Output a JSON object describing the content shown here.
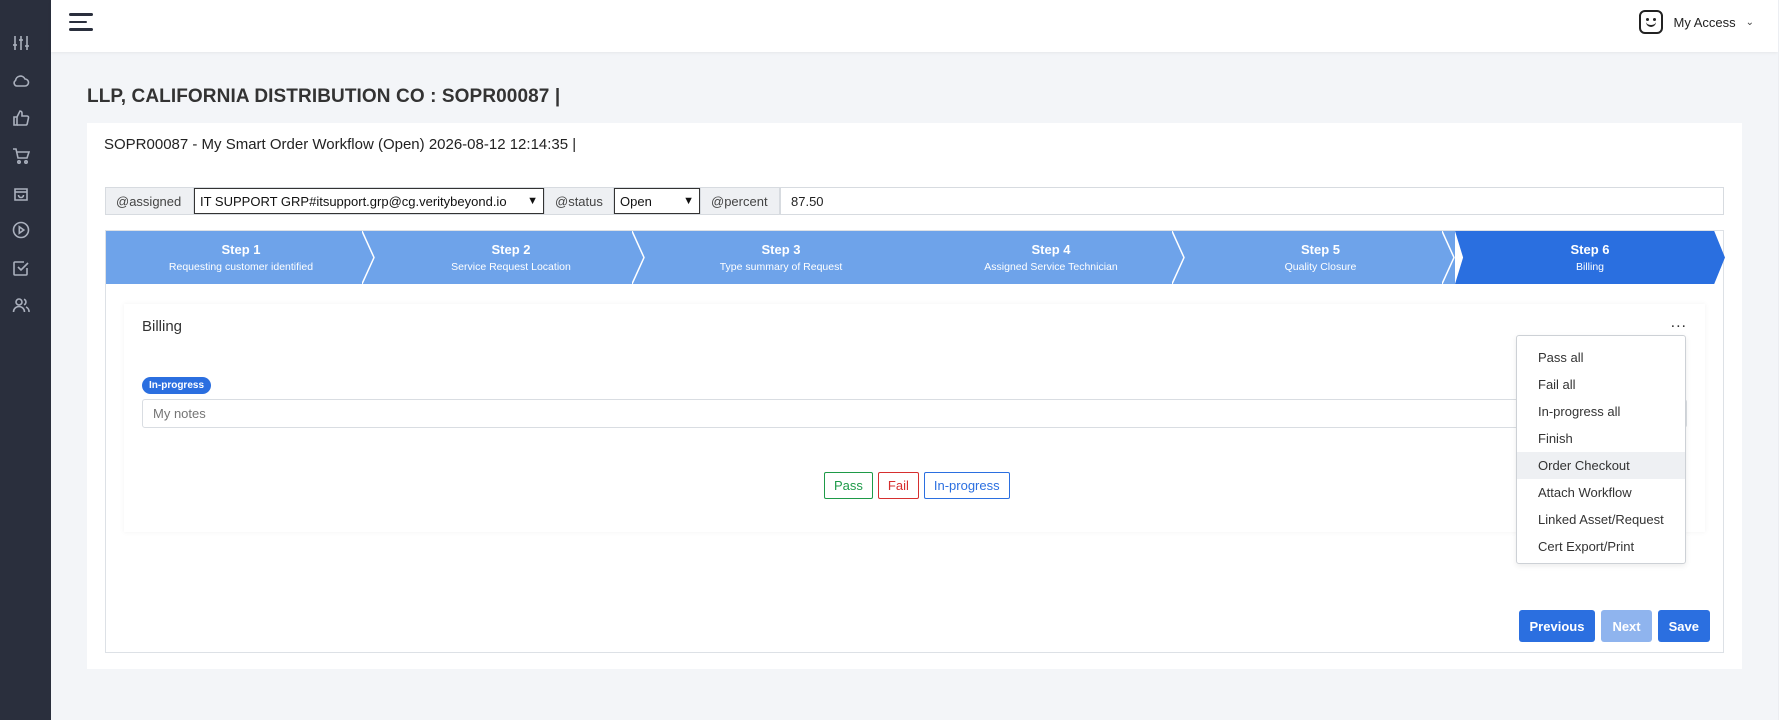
{
  "header": {
    "user_label": "My Access",
    "chevron": "⌄"
  },
  "sidebar": {
    "icons": [
      "sliders-icon",
      "cloud-icon",
      "thumbs-up-icon",
      "cart-icon",
      "bag-icon",
      "play-icon",
      "checkbox-icon",
      "users-icon"
    ]
  },
  "page": {
    "title": "LLP, CALIFORNIA DISTRIBUTION CO : SOPR00087 |",
    "workflow_title": "SOPR00087 - My Smart Order Workflow (Open) 2026-08-12 12:14:35 |"
  },
  "fields": {
    "assigned_label": "@assigned",
    "assigned_value": "IT SUPPORT GRP#itsupport.grp@cg.veritybeyond.io",
    "status_label": "@status",
    "status_value": "Open",
    "percent_label": "@percent",
    "percent_value": "87.50"
  },
  "steps": [
    {
      "num": "Step 1",
      "desc": "Requesting customer identified"
    },
    {
      "num": "Step 2",
      "desc": "Service Request Location"
    },
    {
      "num": "Step 3",
      "desc": "Type summary of Request"
    },
    {
      "num": "Step 4",
      "desc": "Assigned Service Technician"
    },
    {
      "num": "Step 5",
      "desc": "Quality Closure"
    },
    {
      "num": "Step 6",
      "desc": "Billing"
    }
  ],
  "section": {
    "title": "Billing",
    "badge": "In-progress",
    "notes_placeholder": "My notes",
    "ellipsis": "..."
  },
  "actions": {
    "pass": "Pass",
    "fail": "Fail",
    "inprogress": "In-progress"
  },
  "nav": {
    "previous": "Previous",
    "next": "Next",
    "save": "Save"
  },
  "menu": [
    "Pass all",
    "Fail all",
    "In-progress all",
    "Finish",
    "Order Checkout",
    "Attach Workflow",
    "Linked Asset/Request",
    "Cert Export/Print"
  ],
  "colors": {
    "step_inactive": "#6ea3ea",
    "step_active": "#2a6fe0",
    "primary": "#2b6fe0",
    "sidebar_bg": "#2a2f3d"
  }
}
